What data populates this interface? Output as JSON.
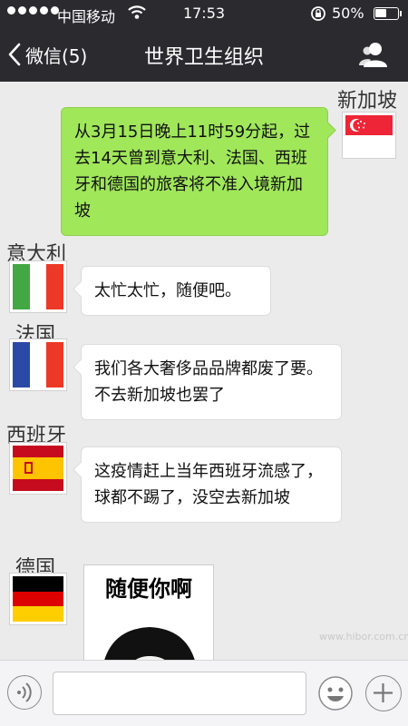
{
  "status_bar": {
    "carrier": "中国移动",
    "time": "17:53",
    "battery_percent": "50%",
    "battery_level": 0.5,
    "signal_dots": 5
  },
  "nav": {
    "back_label": "微信(5)",
    "title": "世界卫生组织"
  },
  "messages": [
    {
      "sender": "新加坡",
      "side": "right",
      "text": "从3月15日晚上11时59分起，过去14天曾到意大利、法国、西班牙和德国的旅客将不准入境新加坡"
    },
    {
      "sender": "意大利",
      "side": "left",
      "text": "太忙太忙，随便吧。"
    },
    {
      "sender": "法国",
      "side": "left",
      "text": "我们各大奢侈品品牌都废了要。不去新加坡也罢了"
    },
    {
      "sender": "西班牙",
      "side": "left",
      "text": "这疫情赶上当年西班牙流感了，球都不踢了，没空去新加坡"
    },
    {
      "sender": "德国",
      "side": "left",
      "sticker_text": "随便你啊"
    }
  ],
  "watermark": "www.hibor.com.cn",
  "input": {
    "value": "",
    "placeholder": ""
  },
  "colors": {
    "bar_background": "#2b2b2f",
    "chat_background": "#ebebeb",
    "outgoing_bubble": "#a0e75a",
    "incoming_bubble": "#ffffff"
  },
  "icons": {
    "back": "chevron-left-icon",
    "contact": "person-icon",
    "voice": "voice-icon",
    "emoji": "emoji-icon",
    "plus": "plus-icon"
  }
}
